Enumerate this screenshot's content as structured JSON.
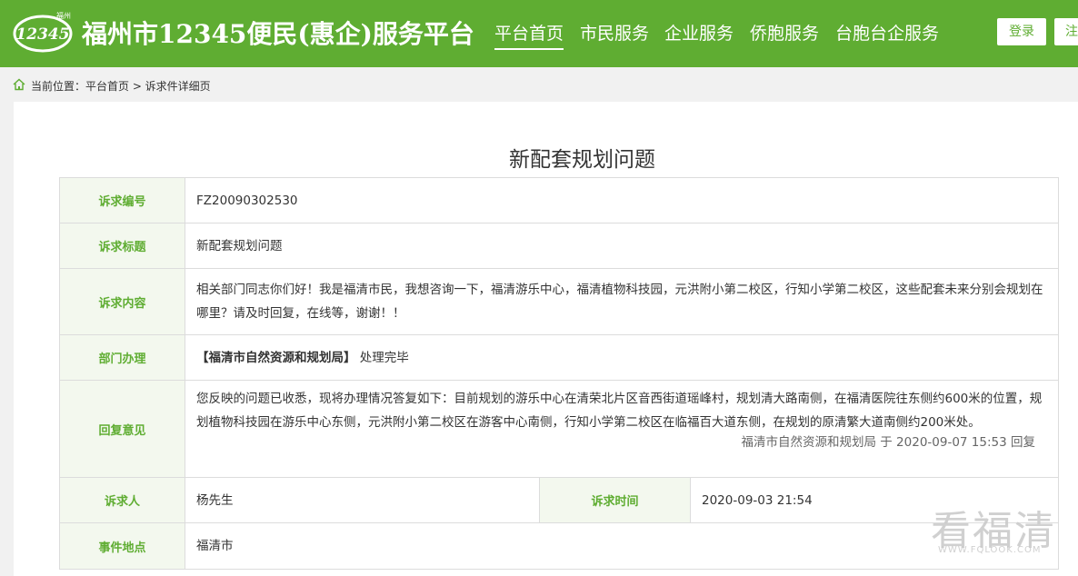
{
  "header": {
    "logo_text": "12345",
    "logo_city": "福州",
    "site_title": "福州市12345便民(惠企)服务平台",
    "nav": [
      {
        "label": "平台首页",
        "active": true
      },
      {
        "label": "市民服务",
        "active": false
      },
      {
        "label": "企业服务",
        "active": false
      },
      {
        "label": "侨胞服务",
        "active": false
      },
      {
        "label": "台胞台企服务",
        "active": false
      }
    ],
    "login_label": "登录",
    "register_label": "注"
  },
  "breadcrumb": {
    "text": "当前位置：平台首页 > 诉求件详细页"
  },
  "page_title": "新配套规划问题",
  "details": {
    "id_label": "诉求编号",
    "id_value": "FZ20090302530",
    "title_label": "诉求标题",
    "title_value": "新配套规划问题",
    "content_label": "诉求内容",
    "content_value": "相关部门同志你们好！我是福清市民，我想咨询一下，福清游乐中心，福清植物科技园，元洪附小第二校区，行知小学第二校区，这些配套未来分别会规划在哪里？请及时回复，在线等，谢谢！！",
    "dept_label": "部门办理",
    "dept_name": "【福清市自然资源和规划局】",
    "dept_status": "处理完毕",
    "reply_label": "回复意见",
    "reply_value": "您反映的问题已收悉，现将办理情况答复如下：目前规划的游乐中心在清荣北片区音西街道瑶峰村，规划清大路南侧，在福清医院往东侧约600米的位置，规划植物科技园在游乐中心东侧，元洪附小第二校区在游客中心南侧，行知小学第二校区在临福百大道东侧，在规划的原清繁大道南侧约200米处。",
    "reply_meta": "福清市自然资源和规划局 于 2020-09-07 15:53 回复",
    "person_label": "诉求人",
    "person_value": "杨先生",
    "time_label": "诉求时间",
    "time_value": "2020-09-03 21:54",
    "location_label": "事件地点",
    "location_value": "福清市"
  },
  "watermark": {
    "big": "看福清",
    "small": "WWW.FQLOOK.COM"
  },
  "colors": {
    "brand_green": "#5fad32",
    "label_bg": "#f3f8ee",
    "border": "#dcdcdc"
  }
}
